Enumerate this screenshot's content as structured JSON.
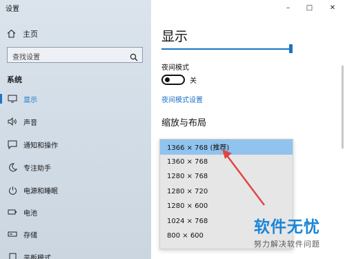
{
  "window": {
    "title": "设置",
    "minimize": "–",
    "maximize": "□",
    "close": "✕"
  },
  "sidebar": {
    "home_label": "主页",
    "search_placeholder": "查找设置",
    "section_title": "系统",
    "items": [
      {
        "label": "显示",
        "icon": "monitor-icon",
        "active": true
      },
      {
        "label": "声音",
        "icon": "speaker-icon"
      },
      {
        "label": "通知和操作",
        "icon": "notification-icon"
      },
      {
        "label": "专注助手",
        "icon": "moon-icon"
      },
      {
        "label": "电源和睡眠",
        "icon": "power-icon"
      },
      {
        "label": "电池",
        "icon": "battery-icon"
      },
      {
        "label": "存储",
        "icon": "storage-icon"
      },
      {
        "label": "平板模式",
        "icon": "tablet-icon"
      }
    ]
  },
  "content": {
    "title": "显示",
    "brightness_level": 1.0,
    "night_light": {
      "label": "夜间模式",
      "state": "关",
      "settings_link": "夜间模式设置"
    },
    "scale_layout_heading": "缩放与布局",
    "resolution_options": [
      {
        "label": "1366 × 768 (推荐)",
        "selected": true
      },
      {
        "label": "1360 × 768"
      },
      {
        "label": "1280 × 768"
      },
      {
        "label": "1280 × 720"
      },
      {
        "label": "1280 × 600"
      },
      {
        "label": "1024 × 768"
      },
      {
        "label": "800 × 600"
      }
    ]
  },
  "watermark": {
    "main": "软件无忧",
    "sub": "努力解决软件问题"
  },
  "colors": {
    "accent": "#1a73c4",
    "selected_option": "#90c4ee",
    "annotation_arrow": "#e04545"
  }
}
